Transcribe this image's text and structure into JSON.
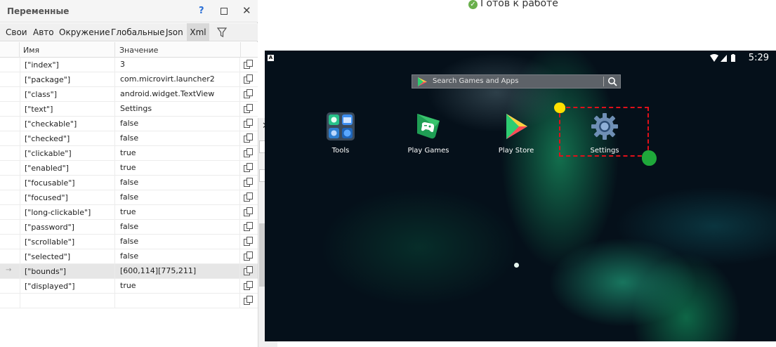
{
  "panel": {
    "title": "Переменные",
    "help": "?",
    "tabs": [
      "Свои",
      "Авто",
      "Окружение",
      "Глобальные",
      "Json",
      "Xml"
    ],
    "active_tab": "Xml",
    "columns": {
      "name": "Имя",
      "value": "Значение"
    },
    "rows": [
      {
        "name": "[\"index\"]",
        "value": "3"
      },
      {
        "name": "[\"package\"]",
        "value": "com.microvirt.launcher2"
      },
      {
        "name": "[\"class\"]",
        "value": "android.widget.TextView"
      },
      {
        "name": "[\"text\"]",
        "value": "Settings"
      },
      {
        "name": "[\"checkable\"]",
        "value": "false"
      },
      {
        "name": "[\"checked\"]",
        "value": "false"
      },
      {
        "name": "[\"clickable\"]",
        "value": "true"
      },
      {
        "name": "[\"enabled\"]",
        "value": "true"
      },
      {
        "name": "[\"focusable\"]",
        "value": "false"
      },
      {
        "name": "[\"focused\"]",
        "value": "false"
      },
      {
        "name": "[\"long-clickable\"]",
        "value": "true"
      },
      {
        "name": "[\"password\"]",
        "value": "false"
      },
      {
        "name": "[\"scrollable\"]",
        "value": "false"
      },
      {
        "name": "[\"selected\"]",
        "value": "false"
      },
      {
        "name": "[\"bounds\"]",
        "value": "[600,114][775,211]"
      },
      {
        "name": "[\"displayed\"]",
        "value": "true"
      },
      {
        "name": "",
        "value": ""
      }
    ],
    "selected_row": 14
  },
  "host": {
    "status": "Готов к работе"
  },
  "emulator": {
    "time": "5:29",
    "search_placeholder": "Search Games and Apps",
    "apps": [
      "Tools",
      "Play Games",
      "Play Store",
      "Settings"
    ],
    "highlight_color": "#e0101a"
  }
}
